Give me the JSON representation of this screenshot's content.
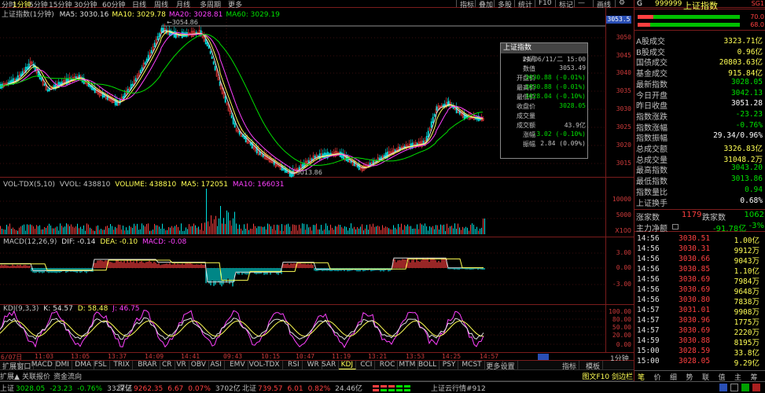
{
  "top_toolbar": {
    "left_items": [
      "分时",
      "1分钟",
      "5分钟",
      "15分钟",
      "30分钟",
      "60分钟",
      "日线",
      "周线",
      "月线",
      "多周期",
      "更多"
    ],
    "selected": "1分钟",
    "right_items": [
      "指标",
      "叠加",
      "多股",
      "统计",
      "F10",
      "标记",
      "—",
      "画线",
      "⚙"
    ]
  },
  "main_panel": {
    "title": "上证指数(1分钟)",
    "ma_values": [
      {
        "label": "MA5: 3030.16",
        "color": "#e0e0e0"
      },
      {
        "label": "MA10: 3029.78",
        "color": "#ffff54"
      },
      {
        "label": "MA20: 3028.81",
        "color": "#ff40ff"
      },
      {
        "label": "MA60: 3029.19",
        "color": "#00e000"
      }
    ],
    "high_label": "3054.86",
    "low_label": "3013.86",
    "right_current": "3053.5",
    "y_ticks": [
      "3050",
      "3045",
      "3040",
      "3035",
      "3030",
      "3025",
      "3020",
      "3015"
    ]
  },
  "tooltip": {
    "title": "上证指数",
    "rows": [
      {
        "k": "时间",
        "v": "24/06/11/二 15:00",
        "color": "#c0c0c0"
      },
      {
        "k": "数值",
        "v": "3053.49",
        "color": "#c0c0c0"
      },
      {
        "k": "开盘价",
        "v": "3030.88 (-0.01%)",
        "color": "#00e000"
      },
      {
        "k": "最高价",
        "v": "3030.88 (-0.01%)",
        "color": "#00e000"
      },
      {
        "k": "最低价",
        "v": "3028.04 (-0.10%)",
        "color": "#00e000"
      },
      {
        "k": "收盘价",
        "v": "3028.05",
        "color": "#00e000"
      },
      {
        "k": "成交量",
        "v": "",
        "color": "#c0c0c0"
      },
      {
        "k": "成交额",
        "v": "43.9亿",
        "color": "#c0c0c0"
      },
      {
        "k": "涨幅",
        "v": "-3.02 (-0.10%)",
        "color": "#00e000"
      },
      {
        "k": "振幅",
        "v": "2.84 (0.09%)",
        "color": "#c0c0c0"
      }
    ]
  },
  "vol_panel": {
    "header": "VOL-TDX(5,10)",
    "vvol": "VVOL: 438810",
    "volume": "VOLUME: 438810",
    "ma5": "MA5: 172051",
    "ma10": "MA10: 166031",
    "y_ticks": [
      "10000",
      "5000"
    ],
    "unit": "X100"
  },
  "macd_panel": {
    "header": "MACD(12,26,9)",
    "dif": "DIF: -0.14",
    "dea": "DEA: -0.10",
    "macd": "MACD: -0.08",
    "y_ticks": [
      "3.00",
      "0.00",
      "-3.00"
    ]
  },
  "kdj_panel": {
    "header": "KDJ(9,3,3)",
    "k": "K: 54.57",
    "d": "D: 58.48",
    "j": "J: 46.75",
    "y_ticks": [
      "100.00",
      "80.00",
      "50.00",
      "20.00",
      "0.00"
    ]
  },
  "time_axis": [
    "6/07日",
    "11:03",
    "13:05",
    "13:37",
    "14:09",
    "14:41",
    "09:43",
    "10:15",
    "10:47",
    "11:19",
    "13:21",
    "13:53",
    "14:25",
    "14:57"
  ],
  "time_axis_right": "1分钟",
  "bottom_tabs": {
    "items": [
      "扩展",
      "窗口",
      "MACD",
      "DMI",
      "DMA",
      "FSL",
      "TRIX",
      "BRAR",
      "CR",
      "VR",
      "OBV",
      "ASI",
      "EMV",
      "VOL-TDX",
      "RSI",
      "WR",
      "SAR",
      "KDJ",
      "CCI",
      "ROC",
      "MTM",
      "BOLL",
      "PSY",
      "MCST",
      "更多",
      "设置"
    ],
    "selected": "KDJ",
    "right": [
      "指标",
      "模板"
    ]
  },
  "bottom_links": [
    "扩展▲",
    "关联报价",
    "资金流向"
  ],
  "right_panel": {
    "code": "G",
    "code_num": "999999",
    "name": "上证指数",
    "badge": "SG1",
    "ratio1": "70.0",
    "ratio2": "68.0",
    "stats": [
      {
        "label": "A股成交",
        "value": "3323.71亿",
        "color": "#ffff54"
      },
      {
        "label": "B股成交",
        "value": "0.96亿",
        "color": "#ffff54"
      },
      {
        "label": "国债成交",
        "value": "20803.63亿",
        "color": "#ffff54"
      },
      {
        "label": "基金成交",
        "value": "915.84亿",
        "color": "#ffff54"
      },
      {
        "label": "最新指数",
        "value": "3028.05",
        "color": "#00e000"
      },
      {
        "label": "今日开盘",
        "value": "3042.13",
        "color": "#00e000"
      },
      {
        "label": "昨日收盘",
        "value": "3051.28",
        "color": "#ffffff"
      },
      {
        "label": "指数涨跌",
        "value": "-23.23",
        "color": "#00e000"
      },
      {
        "label": "指数涨幅",
        "value": "-0.76%",
        "color": "#00e000"
      },
      {
        "label": "指数振幅",
        "value": "29.34/0.96%",
        "color": "#ffffff"
      },
      {
        "label": "总成交额",
        "value": "3326.83亿",
        "color": "#ffff54"
      },
      {
        "label": "总成交量",
        "value": "31048.2万",
        "color": "#ffff54"
      },
      {
        "label": "最高指数",
        "value": "3043.20",
        "color": "#00e000"
      },
      {
        "label": "最低指数",
        "value": "3013.86",
        "color": "#00e000"
      },
      {
        "label": "指数量比",
        "value": "0.94",
        "color": "#00e000"
      },
      {
        "label": "上证换手",
        "value": "0.68%",
        "color": "#ffffff"
      }
    ],
    "updown": {
      "rise_label": "涨家数",
      "rise": "1179",
      "fall_label": "跌家数",
      "fall": "1062"
    },
    "main_flow": {
      "label": "主力净额",
      "value": "-91.78亿",
      "pct": "-3%"
    },
    "ticks": [
      {
        "t": "14:56",
        "p": "3030.51",
        "q": "1.00亿"
      },
      {
        "t": "14:56",
        "p": "3030.31",
        "q": "9912万"
      },
      {
        "t": "14:56",
        "p": "3030.66",
        "q": "9043万"
      },
      {
        "t": "14:56",
        "p": "3030.85",
        "q": "1.10亿"
      },
      {
        "t": "14:56",
        "p": "3030.69",
        "q": "7984万"
      },
      {
        "t": "14:56",
        "p": "3030.69",
        "q": "9648万"
      },
      {
        "t": "14:56",
        "p": "3030.80",
        "q": "7838万"
      },
      {
        "t": "14:57",
        "p": "3031.01",
        "q": "9908万"
      },
      {
        "t": "14:57",
        "p": "3030.96",
        "q": "1775万"
      },
      {
        "t": "14:57",
        "p": "3030.69",
        "q": "2220万"
      },
      {
        "t": "14:59",
        "p": "3030.88",
        "q": "8195万"
      },
      {
        "t": "15:00",
        "p": "3028.59",
        "q": "33.8亿"
      },
      {
        "t": "15:00",
        "p": "3028.05",
        "q": "9.29亿"
      }
    ],
    "bottom_tabs": [
      "笔",
      "价",
      "细",
      "势",
      "联",
      "值",
      "主",
      "筹"
    ]
  },
  "bottom_right_banner": "图文F10 剑边栏",
  "status_bar": {
    "items": [
      {
        "label": "上证",
        "value": "3028.05",
        "chg": "-23.23",
        "pct": "-0.76%",
        "amt": "3327亿"
      },
      {
        "label": "深证",
        "value": "9262.35",
        "chg": "6.67",
        "pct": "0.07%",
        "amt": "3702亿"
      },
      {
        "label": "北证",
        "value": "739.57",
        "chg": "6.01",
        "pct": "0.82%",
        "amt": "24.46亿"
      }
    ],
    "right_text": "上证云行情#912"
  },
  "colors": {
    "up": "#ff4040",
    "down": "#00e000",
    "accent": "#ffff54",
    "grid": "#7a1c1c"
  }
}
